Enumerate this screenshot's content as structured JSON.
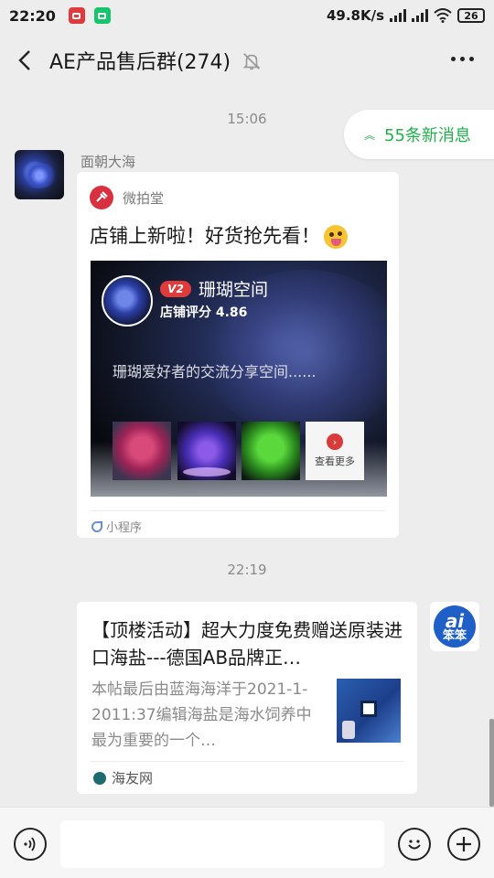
{
  "status_bar": {
    "time": "22:20",
    "network_speed": "49.8K/s",
    "battery": "26"
  },
  "header": {
    "title": "AE产品售后群(274)"
  },
  "new_messages": {
    "label": "55条新消息"
  },
  "messages": [
    {
      "timestamp": "15:06",
      "sender": "面朝大海",
      "type": "mini-program",
      "app_name": "微拍堂",
      "title": "店铺上新啦！好货抢先看！",
      "shop": {
        "level_badge": "V2",
        "name": "珊瑚空间",
        "rating_label": "店铺评分 4.86",
        "description": "珊瑚爱好者的交流分享空间......",
        "more_label": "查看更多"
      },
      "footer": "小程序"
    },
    {
      "timestamp": "22:19",
      "type": "article",
      "title": "【顶楼活动】超大力度免费赠送原装进口海盐---德国AB品牌正…",
      "description": "本帖最后由蓝海海洋于2021-1-2011:37编辑海盐是海水饲养中最为重要的一个…",
      "source": "海友网"
    }
  ],
  "input_bar": {
    "placeholder": ""
  },
  "colors": {
    "accent_green": "#20b04b",
    "background": "#ededed",
    "badge_red": "#e03a3a"
  }
}
